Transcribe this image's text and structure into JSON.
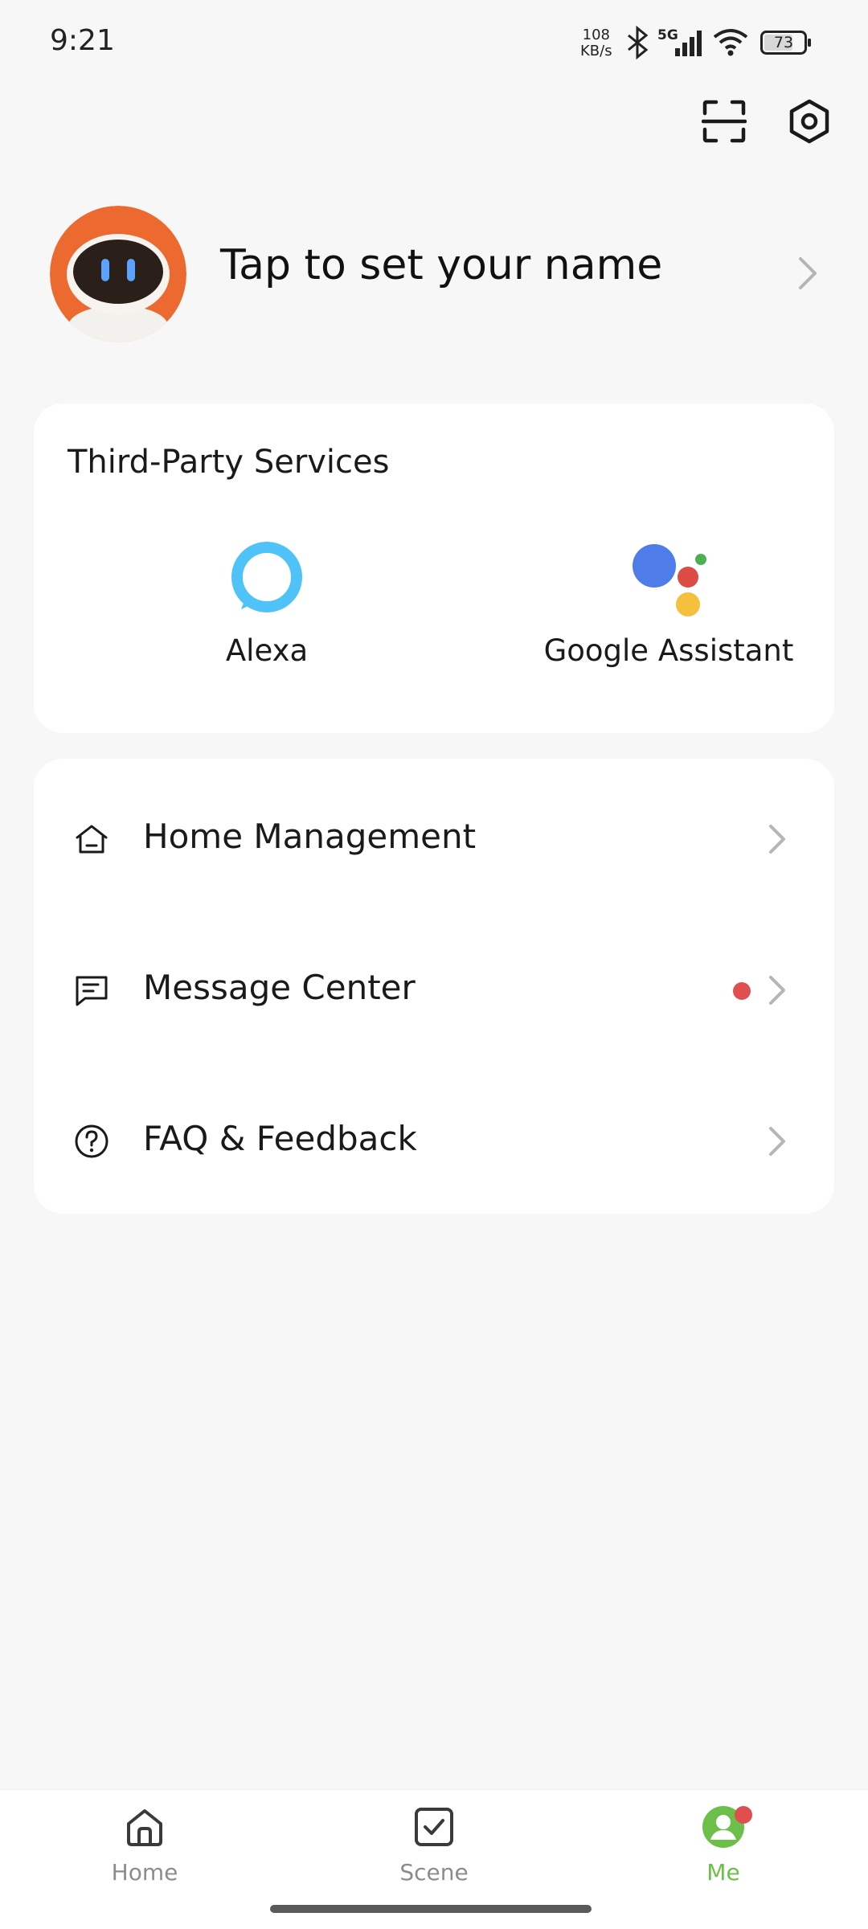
{
  "status_bar": {
    "time": "9:21",
    "net_speed_value": "108",
    "net_speed_unit": "KB/s",
    "network_type": "5G",
    "battery_level": "73",
    "icons": [
      "bluetooth-icon",
      "signal-icon",
      "wifi-icon",
      "battery-icon"
    ]
  },
  "header": {
    "actions": [
      "scan-icon",
      "settings-icon"
    ]
  },
  "profile": {
    "name_prompt": "Tap to set your name",
    "avatar_icon": "robot-avatar"
  },
  "services": {
    "title": "Third-Party Services",
    "items": [
      {
        "label": "Alexa",
        "icon": "alexa-icon"
      },
      {
        "label": "Google Assistant",
        "icon": "google-assistant-icon"
      }
    ]
  },
  "menu": {
    "items": [
      {
        "label": "Home Management",
        "icon": "home-icon",
        "has_badge": false
      },
      {
        "label": "Message Center",
        "icon": "message-icon",
        "has_badge": true
      },
      {
        "label": "FAQ & Feedback",
        "icon": "help-icon",
        "has_badge": false
      }
    ]
  },
  "bottom_nav": {
    "items": [
      {
        "label": "Home",
        "icon": "home-icon",
        "active": false
      },
      {
        "label": "Scene",
        "icon": "scene-check-icon",
        "active": false
      },
      {
        "label": "Me",
        "icon": "profile-icon",
        "active": true,
        "has_badge": true
      }
    ]
  },
  "colors": {
    "background": "#f7f7f7",
    "card": "#ffffff",
    "accent_green": "#6cc04a",
    "badge_red": "#e04f4f",
    "alexa_blue": "#4fc3f7",
    "google_blue": "#4e7ce8",
    "google_red": "#dc4c45",
    "google_yellow": "#f4c03d",
    "google_green": "#4caf50"
  }
}
